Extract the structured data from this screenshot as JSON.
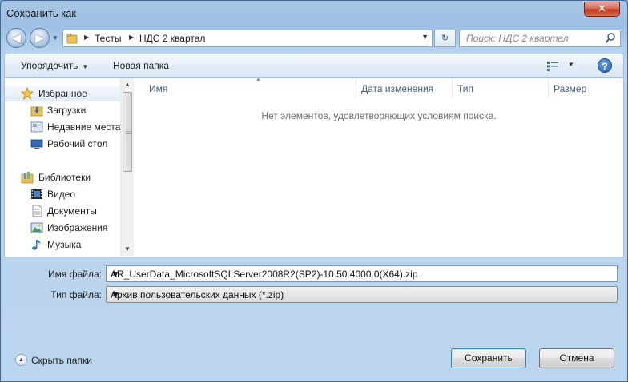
{
  "window": {
    "title": "Сохранить как",
    "close_glyph": "✕"
  },
  "nav": {
    "back_glyph": "◀",
    "forward_glyph": "▶",
    "breadcrumb": [
      "Тесты",
      "НДС 2 квартал"
    ],
    "search_placeholder": "Поиск: НДС 2 квартал"
  },
  "toolbar": {
    "organize_label": "Упорядочить",
    "new_folder_label": "Новая папка",
    "help_glyph": "?"
  },
  "sidebar": {
    "items": [
      {
        "label": "Избранное",
        "icon": "star-icon"
      },
      {
        "label": "Загрузки",
        "icon": "downloads-folder-icon"
      },
      {
        "label": "Недавние места",
        "icon": "recent-places-icon"
      },
      {
        "label": "Рабочий стол",
        "icon": "desktop-icon"
      },
      {
        "label": "Библиотеки",
        "icon": "libraries-icon"
      },
      {
        "label": "Видео",
        "icon": "video-icon"
      },
      {
        "label": "Документы",
        "icon": "documents-icon"
      },
      {
        "label": "Изображения",
        "icon": "pictures-icon"
      },
      {
        "label": "Музыка",
        "icon": "music-icon"
      }
    ]
  },
  "columns": [
    "Имя",
    "Дата изменения",
    "Тип",
    "Размер"
  ],
  "empty_message": "Нет элементов, удовлетворяющих условиям поиска.",
  "form": {
    "filename_label": "Имя файла:",
    "filename_value": "AR_UserData_MicrosoftSQLServer2008R2(SP2)-10.50.4000.0(X64).zip",
    "filetype_label": "Тип файла:",
    "filetype_value": "Архив пользовательских данных (*.zip)"
  },
  "footer": {
    "hide_folders_label": "Скрыть папки",
    "save_label": "Сохранить",
    "cancel_label": "Отмена"
  },
  "colors": {
    "accent": "#3c7fb1",
    "frame": "#a9c7e6"
  }
}
